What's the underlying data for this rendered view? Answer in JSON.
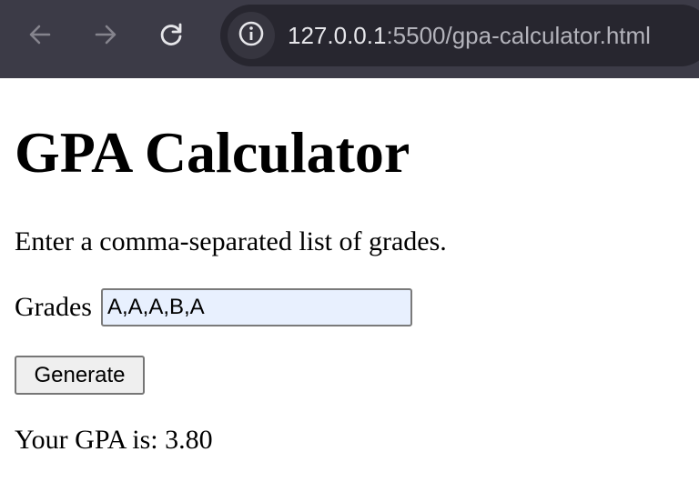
{
  "browser": {
    "url_host": "127.0.0.1",
    "url_rest": ":5500/gpa-calculator.html",
    "icons": {
      "back": "back-arrow-icon",
      "forward": "forward-arrow-icon",
      "reload": "reload-icon",
      "site_info": "info-icon"
    },
    "colors": {
      "toolbar": "#3c3b47",
      "omnibox": "#27262f"
    }
  },
  "page": {
    "title": "GPA Calculator",
    "instructions": "Enter a comma-separated list of grades.",
    "grades_label": "Grades",
    "grades_value": "A,A,A,B,A",
    "generate_label": "Generate",
    "result_text": "Your GPA is: 3.80"
  }
}
